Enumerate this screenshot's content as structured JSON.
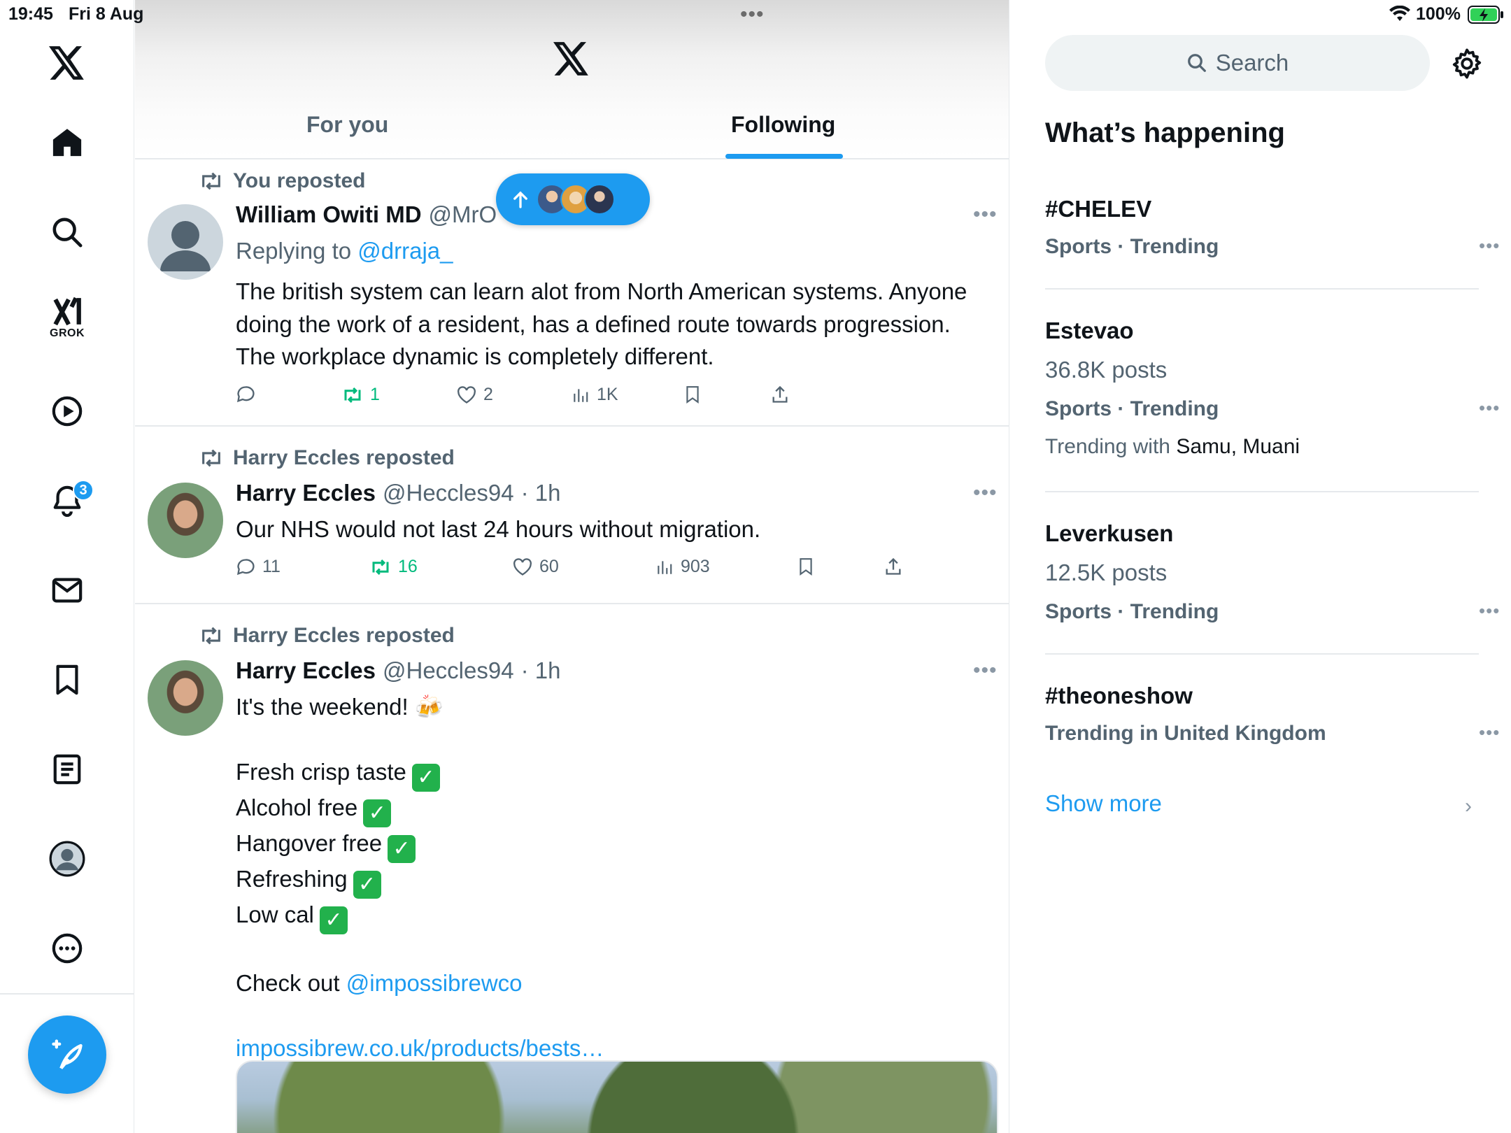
{
  "status_bar": {
    "time": "19:45",
    "date": "Fri 8 Aug",
    "battery": "100%",
    "multitask_dots": "•••"
  },
  "left_nav": {
    "items": [
      {
        "name": "logo",
        "icon": "x-logo-icon"
      },
      {
        "name": "home",
        "icon": "home-icon"
      },
      {
        "name": "explore",
        "icon": "search-icon"
      },
      {
        "name": "grok",
        "icon": "grok-icon",
        "label": "GROK"
      },
      {
        "name": "videos",
        "icon": "play-icon"
      },
      {
        "name": "notifications",
        "icon": "bell-icon",
        "badge": "3"
      },
      {
        "name": "messages",
        "icon": "mail-icon"
      },
      {
        "name": "bookmarks",
        "icon": "bookmark-icon"
      },
      {
        "name": "lists",
        "icon": "list-icon"
      },
      {
        "name": "profile",
        "icon": "avatar-icon"
      },
      {
        "name": "more",
        "icon": "more-circle-icon"
      }
    ],
    "compose_icon": "compose-feather-icon"
  },
  "main": {
    "tabs": [
      {
        "label": "For you",
        "active": false
      },
      {
        "label": "Following",
        "active": true
      }
    ],
    "new_posts_pill": {
      "icon": "arrow-up-icon"
    },
    "posts": [
      {
        "repost_label": "You reposted",
        "name": "William Owiti MD",
        "handle": "@MrO",
        "replying_prefix": "Replying to",
        "replying_to": "@drraja_",
        "text": "The british system can learn alot from North American systems. Anyone doing the work of a resident, has a defined route towards progression.  The workplace dynamic is completely different.",
        "replies": "",
        "reposts": "1",
        "likes": "2",
        "views": "1K"
      },
      {
        "repost_label": "Harry Eccles reposted",
        "name": "Harry Eccles",
        "handle": "@Heccles94",
        "time": "· 1h",
        "text": "Our NHS would not last 24 hours without migration.",
        "replies": "11",
        "reposts": "16",
        "likes": "60",
        "views": "903"
      },
      {
        "repost_label": "Harry Eccles reposted",
        "name": "Harry Eccles",
        "handle": "@Heccles94",
        "time": "· 1h",
        "intro": "It's the weekend! 🍻",
        "list": [
          "Fresh crisp taste",
          "Alcohol free",
          "Hangover free",
          "Refreshing",
          "Low cal"
        ],
        "checkout_prefix": "Check out",
        "checkout_mention": "@impossibrewco",
        "url": "impossibrew.co.uk/products/bests…"
      }
    ]
  },
  "right": {
    "search_placeholder": "Search",
    "section_title": "What’s happening",
    "trends": [
      {
        "name": "#CHELEV",
        "meta": "Sports · Trending"
      },
      {
        "name": "Estevao",
        "count": "36.8K posts",
        "meta": "Sports · Trending",
        "with_prefix": "Trending with",
        "with": "Samu, Muani"
      },
      {
        "name": "Leverkusen",
        "count": "12.5K posts",
        "meta": "Sports · Trending"
      },
      {
        "name": "#theoneshow",
        "meta": "Trending in United Kingdom"
      }
    ],
    "show_more": "Show more"
  },
  "colors": {
    "accent": "#1d9bf0",
    "repost_green": "#00ba7c",
    "muted": "#536471"
  }
}
